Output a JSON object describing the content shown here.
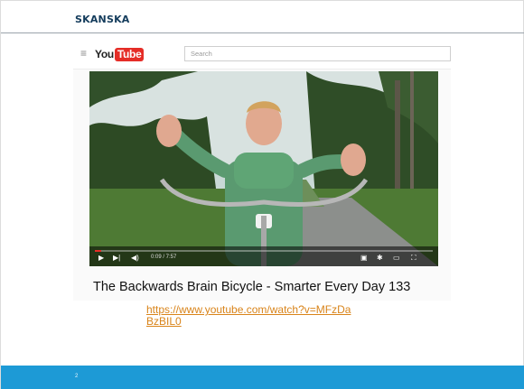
{
  "slide": {
    "brand": "SKANSKA",
    "page_number": "2",
    "link_text": "https://www.youtube.com/watch?v=MFzDaBzBIL0",
    "colors": {
      "brand_text": "#143c5c",
      "footer": "#1d9ad6",
      "link": "#d9841a"
    }
  },
  "youtube": {
    "logo_you": "You",
    "logo_tube": "Tube",
    "search_placeholder": "Search",
    "time": "0:09 / 7:57",
    "progress_fraction": 0.02,
    "video_title": "The Backwards Brain Bicycle - Smarter Every Day 133",
    "icons": [
      "menu-icon",
      "play-icon",
      "next-icon",
      "volume-icon",
      "subtitles-icon",
      "settings-icon",
      "theater-icon",
      "fullscreen-icon"
    ]
  }
}
